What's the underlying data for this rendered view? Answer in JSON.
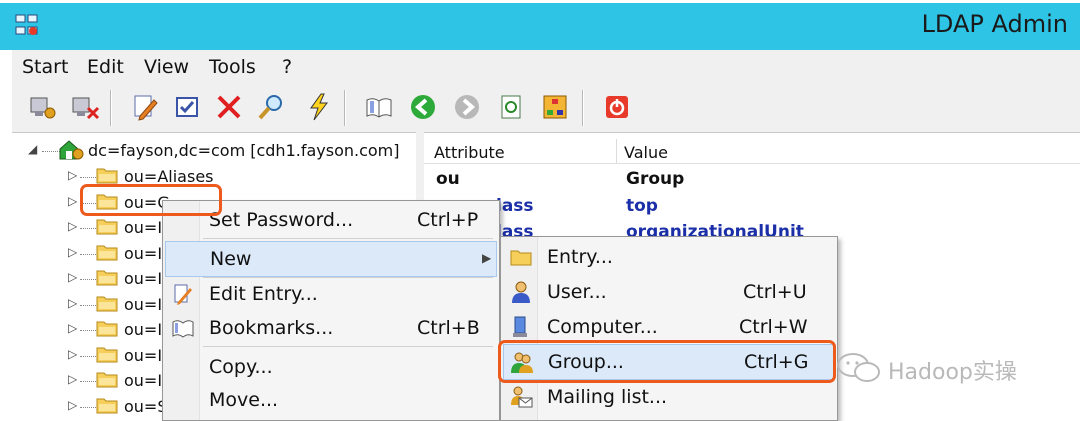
{
  "window": {
    "title": "LDAP Admin"
  },
  "menubar": {
    "items": [
      "Start",
      "Edit",
      "View",
      "Tools",
      "?"
    ]
  },
  "toolbar": {
    "icons": [
      "connect-icon",
      "disconnect-icon",
      "edit-icon",
      "properties-icon",
      "delete-icon",
      "search-icon",
      "quick-search-icon",
      "bookmarks-icon",
      "back-icon",
      "forward-icon",
      "refresh-icon",
      "schema-icon",
      "exit-icon"
    ]
  },
  "tree": {
    "root": "dc=fayson,dc=com [cdh1.fayson.com]",
    "nodes": [
      "ou=Aliases",
      "ou=G",
      "ou=I",
      "ou=I",
      "ou=I",
      "ou=I",
      "ou=I",
      "ou=I",
      "ou=I",
      "ou=S"
    ]
  },
  "grid": {
    "headers": {
      "attribute": "Attribute",
      "value": "Value"
    },
    "rows": [
      {
        "attribute": "ou",
        "value": "Group"
      },
      {
        "attribute": "lass",
        "value": "top"
      },
      {
        "attribute": "lass",
        "value": "organizationalUnit"
      }
    ]
  },
  "context_menu": {
    "items": [
      {
        "label": "Set Password...",
        "shortcut": "Ctrl+P"
      },
      {
        "label": "New",
        "shortcut": ""
      },
      {
        "label": "Edit Entry...",
        "shortcut": ""
      },
      {
        "label": "Bookmarks...",
        "shortcut": "Ctrl+B"
      },
      {
        "label": "Copy...",
        "shortcut": ""
      },
      {
        "label": "Move...",
        "shortcut": ""
      }
    ]
  },
  "submenu": {
    "items": [
      {
        "label": "Entry...",
        "shortcut": ""
      },
      {
        "label": "User...",
        "shortcut": "Ctrl+U"
      },
      {
        "label": "Computer...",
        "shortcut": "Ctrl+W"
      },
      {
        "label": "Group...",
        "shortcut": "Ctrl+G"
      },
      {
        "label": "Mailing list...",
        "shortcut": ""
      }
    ]
  },
  "watermark": {
    "text": "Hadoop实操"
  },
  "colors": {
    "titlebar": "#2ec4e6",
    "highlight": "#dbe9f9",
    "callout": "#ee5a1c",
    "value_blue": "#1b2fa8"
  }
}
